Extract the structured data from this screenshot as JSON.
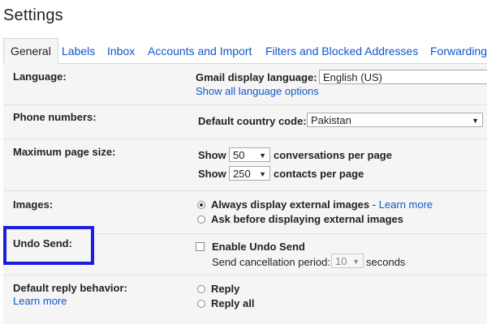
{
  "page": {
    "title": "Settings"
  },
  "tabs": [
    {
      "label": "General",
      "active": true
    },
    {
      "label": "Labels"
    },
    {
      "label": "Inbox"
    },
    {
      "label": "Accounts and Import"
    },
    {
      "label": "Filters and Blocked Addresses"
    },
    {
      "label": "Forwarding"
    }
  ],
  "language": {
    "label": "Language:",
    "display_label": "Gmail display language:",
    "value": "English (US)",
    "link": "Show all language options"
  },
  "phone": {
    "label": "Phone numbers:",
    "country_label": "Default country code:",
    "value": "Pakistan"
  },
  "page_size": {
    "label": "Maximum page size:",
    "show": "Show",
    "conversations_value": "50",
    "conversations_suffix": "conversations per page",
    "contacts_value": "250",
    "contacts_suffix": "contacts per page"
  },
  "images": {
    "label": "Images:",
    "option1": "Always display external images",
    "separator": " - ",
    "learn_more": "Learn more",
    "option2": "Ask before displaying external images"
  },
  "undo_send": {
    "label": "Undo Send:",
    "checkbox_label": "Enable Undo Send",
    "period_label": "Send cancellation period:",
    "period_value": "10",
    "period_suffix": "seconds"
  },
  "reply": {
    "label": "Default reply behavior:",
    "learn_more": "Learn more",
    "option1": "Reply",
    "option2": "Reply all"
  },
  "colors": {
    "link": "#1155cc",
    "highlight": "#1d1de0",
    "panel_bg": "#f5f5f5"
  }
}
